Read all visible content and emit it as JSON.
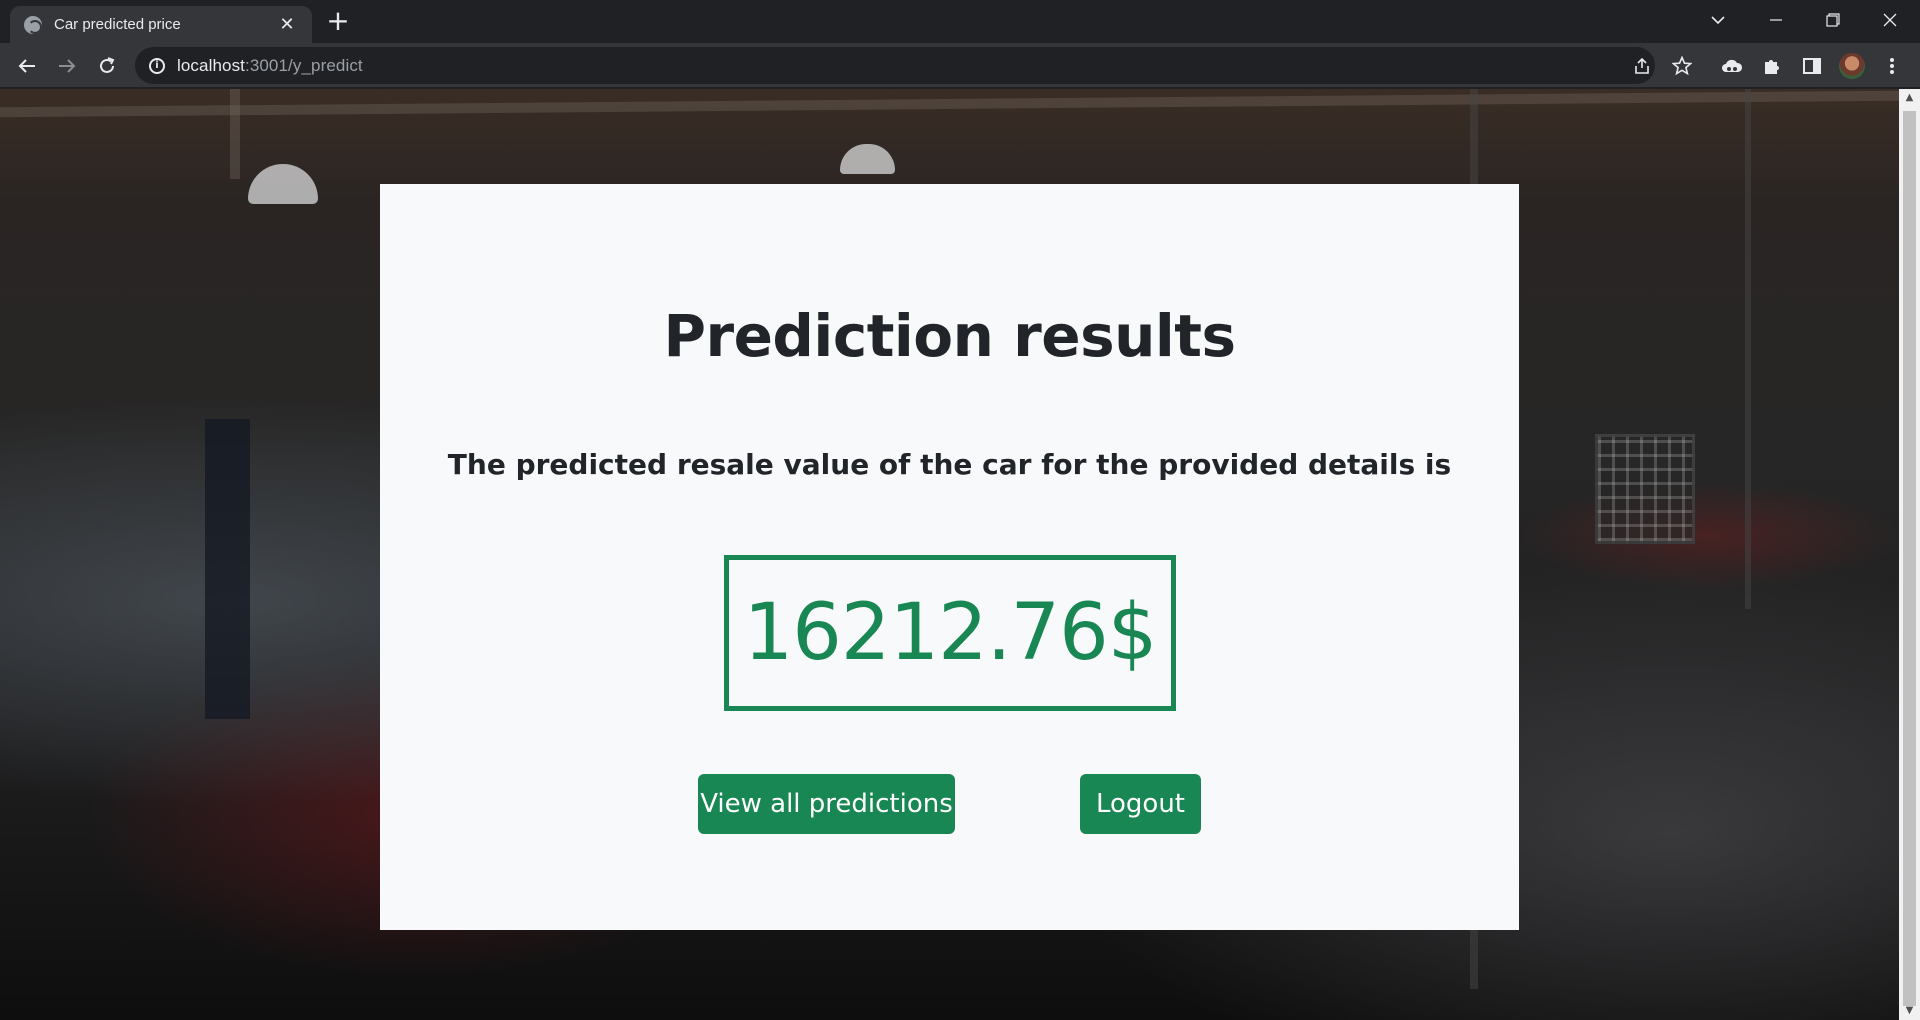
{
  "browser": {
    "tab": {
      "title": "Car predicted price",
      "close_icon": "close-icon",
      "favicon": "globe-icon"
    },
    "new_tab_icon": "plus-icon",
    "window_controls": {
      "tab_search": "chevron-down-icon",
      "minimize": "minimize-icon",
      "restore": "restore-icon",
      "close": "close-icon"
    },
    "address": {
      "host": "localhost",
      "path": ":3001/y_predict"
    },
    "icons": [
      "back-arrow-icon",
      "forward-arrow-icon",
      "reload-icon",
      "site-info-icon",
      "share-icon",
      "star-icon",
      "extension-cloud-icon",
      "puzzle-icon",
      "side-panel-icon",
      "profile-avatar",
      "kebab-menu-icon"
    ]
  },
  "page": {
    "heading": "Prediction results",
    "subtitle": "The predicted resale value of the car for the provided details is",
    "result": "16212.76$",
    "buttons": {
      "view_all": "View all predictions",
      "logout": "Logout"
    },
    "colors": {
      "accent": "#198754",
      "card_bg": "#f8f9fa",
      "text": "#212529"
    }
  }
}
